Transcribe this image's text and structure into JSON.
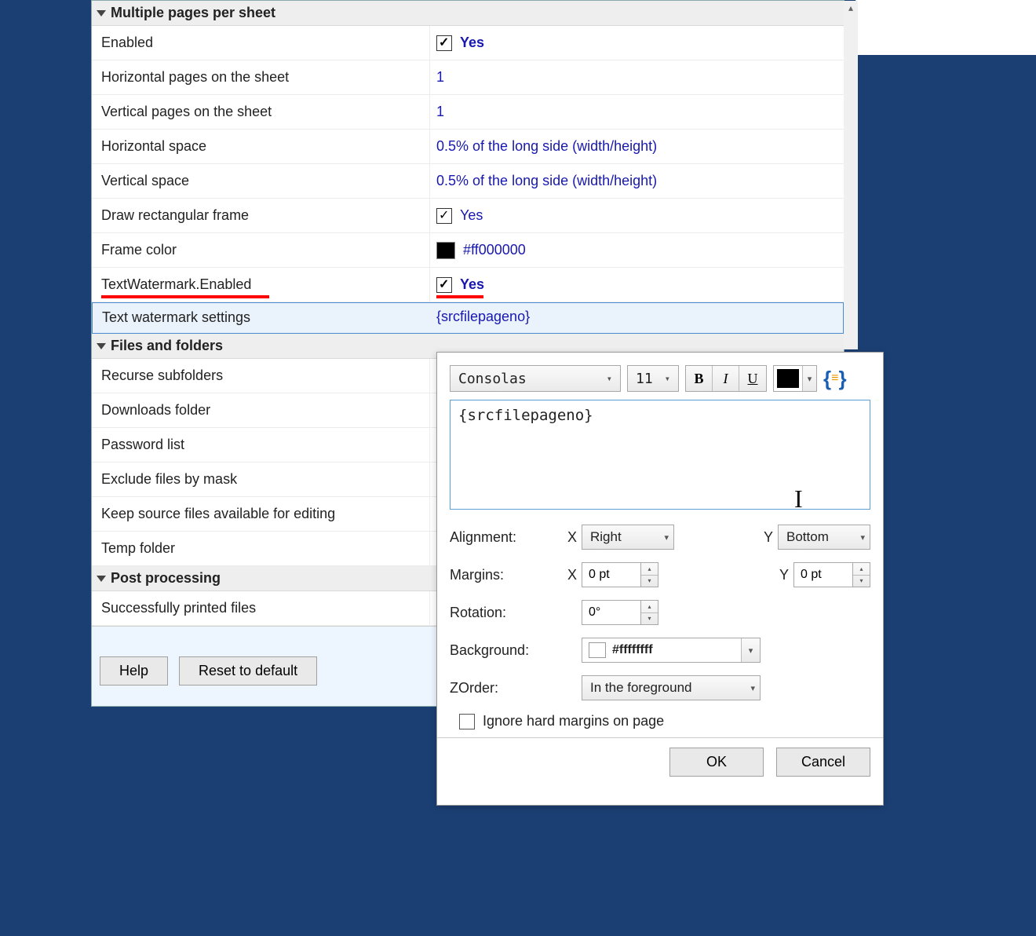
{
  "sections": {
    "multiple_pages": {
      "title": "Multiple pages per sheet",
      "rows": {
        "enabled": {
          "label": "Enabled",
          "value": "Yes"
        },
        "hpages": {
          "label": "Horizontal pages on the sheet",
          "value": "1"
        },
        "vpages": {
          "label": "Vertical pages on the sheet",
          "value": "1"
        },
        "hspace": {
          "label": "Horizontal space",
          "value": "0.5% of the long side (width/height)"
        },
        "vspace": {
          "label": "Vertical space",
          "value": "0.5% of the long side (width/height)"
        },
        "frame": {
          "label": "Draw rectangular frame",
          "value": "Yes"
        },
        "framecolor": {
          "label": "Frame color",
          "value": "#ff000000"
        },
        "twm_enabled": {
          "label": "TextWatermark.Enabled",
          "value": "Yes"
        },
        "twm_settings": {
          "label": "Text watermark settings",
          "value": "{srcfilepageno}"
        }
      }
    },
    "files_folders": {
      "title": "Files and folders",
      "rows": {
        "recurse": {
          "label": "Recurse subfolders"
        },
        "downloads": {
          "label": "Downloads folder"
        },
        "password": {
          "label": "Password list"
        },
        "exclude": {
          "label": "Exclude files by mask"
        },
        "keepsrc": {
          "label": "Keep source files available for editing"
        },
        "temp": {
          "label": "Temp folder"
        }
      }
    },
    "post": {
      "title": "Post processing",
      "rows": {
        "success": {
          "label": "Successfully printed files"
        }
      }
    }
  },
  "buttons": {
    "help": "Help",
    "reset": "Reset to default"
  },
  "popup": {
    "font": "Consolas",
    "font_size": "11",
    "text": "{srcfilepageno}",
    "alignment_label": "Alignment:",
    "margins_label": "Margins:",
    "rotation_label": "Rotation:",
    "background_label": "Background:",
    "zorder_label": "ZOrder:",
    "x_label": "X",
    "y_label": "Y",
    "align_x": "Right",
    "align_y": "Bottom",
    "margin_x": "0 pt",
    "margin_y": "0 pt",
    "rotation": "0°",
    "bg_color": "#ffffffff",
    "zorder": "In the foreground",
    "ignore_margins": "Ignore hard margins on page",
    "ok": "OK",
    "cancel": "Cancel"
  }
}
